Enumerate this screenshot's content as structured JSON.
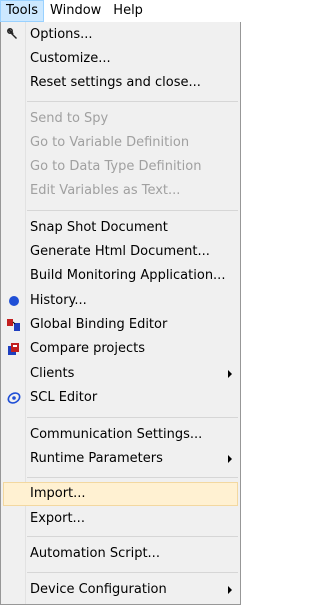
{
  "menubar": {
    "items": [
      {
        "label": "Tools"
      },
      {
        "label": "Window"
      },
      {
        "label": "Help"
      }
    ]
  },
  "menu": {
    "items": [
      {
        "label": "Options...",
        "state": "normal",
        "icon": "wrench-icon"
      },
      {
        "label": "Customize...",
        "state": "normal"
      },
      {
        "label": "Reset settings and close...",
        "state": "normal"
      },
      {
        "label": "Send to Spy",
        "state": "disabled"
      },
      {
        "label": "Go to Variable Definition",
        "state": "disabled"
      },
      {
        "label": "Go to Data Type Definition",
        "state": "disabled"
      },
      {
        "label": "Edit Variables as Text...",
        "state": "disabled"
      },
      {
        "label": "Snap Shot Document",
        "state": "normal"
      },
      {
        "label": "Generate Html Document...",
        "state": "normal"
      },
      {
        "label": "Build Monitoring Application...",
        "state": "normal"
      },
      {
        "label": "History...",
        "state": "normal",
        "icon": "history-icon"
      },
      {
        "label": "Global Binding Editor",
        "state": "normal",
        "icon": "binding-editor-icon"
      },
      {
        "label": "Compare projects",
        "state": "normal",
        "icon": "compare-projects-icon"
      },
      {
        "label": "Clients",
        "state": "normal",
        "submenu": true
      },
      {
        "label": "SCL Editor",
        "state": "normal",
        "icon": "scl-editor-icon"
      },
      {
        "label": "Communication Settings...",
        "state": "normal"
      },
      {
        "label": "Runtime Parameters",
        "state": "normal",
        "submenu": true
      },
      {
        "label": "Import...",
        "state": "highlighted"
      },
      {
        "label": "Export...",
        "state": "normal"
      },
      {
        "label": "Automation Script...",
        "state": "normal"
      },
      {
        "label": "Device Configuration",
        "state": "normal",
        "submenu": true
      }
    ]
  },
  "colors": {
    "menu_bg": "#f0f0f0",
    "highlight_bg": "#fff1d2",
    "disabled_text": "#a0a0a0",
    "active_menubar_bg": "#cce8ff"
  }
}
